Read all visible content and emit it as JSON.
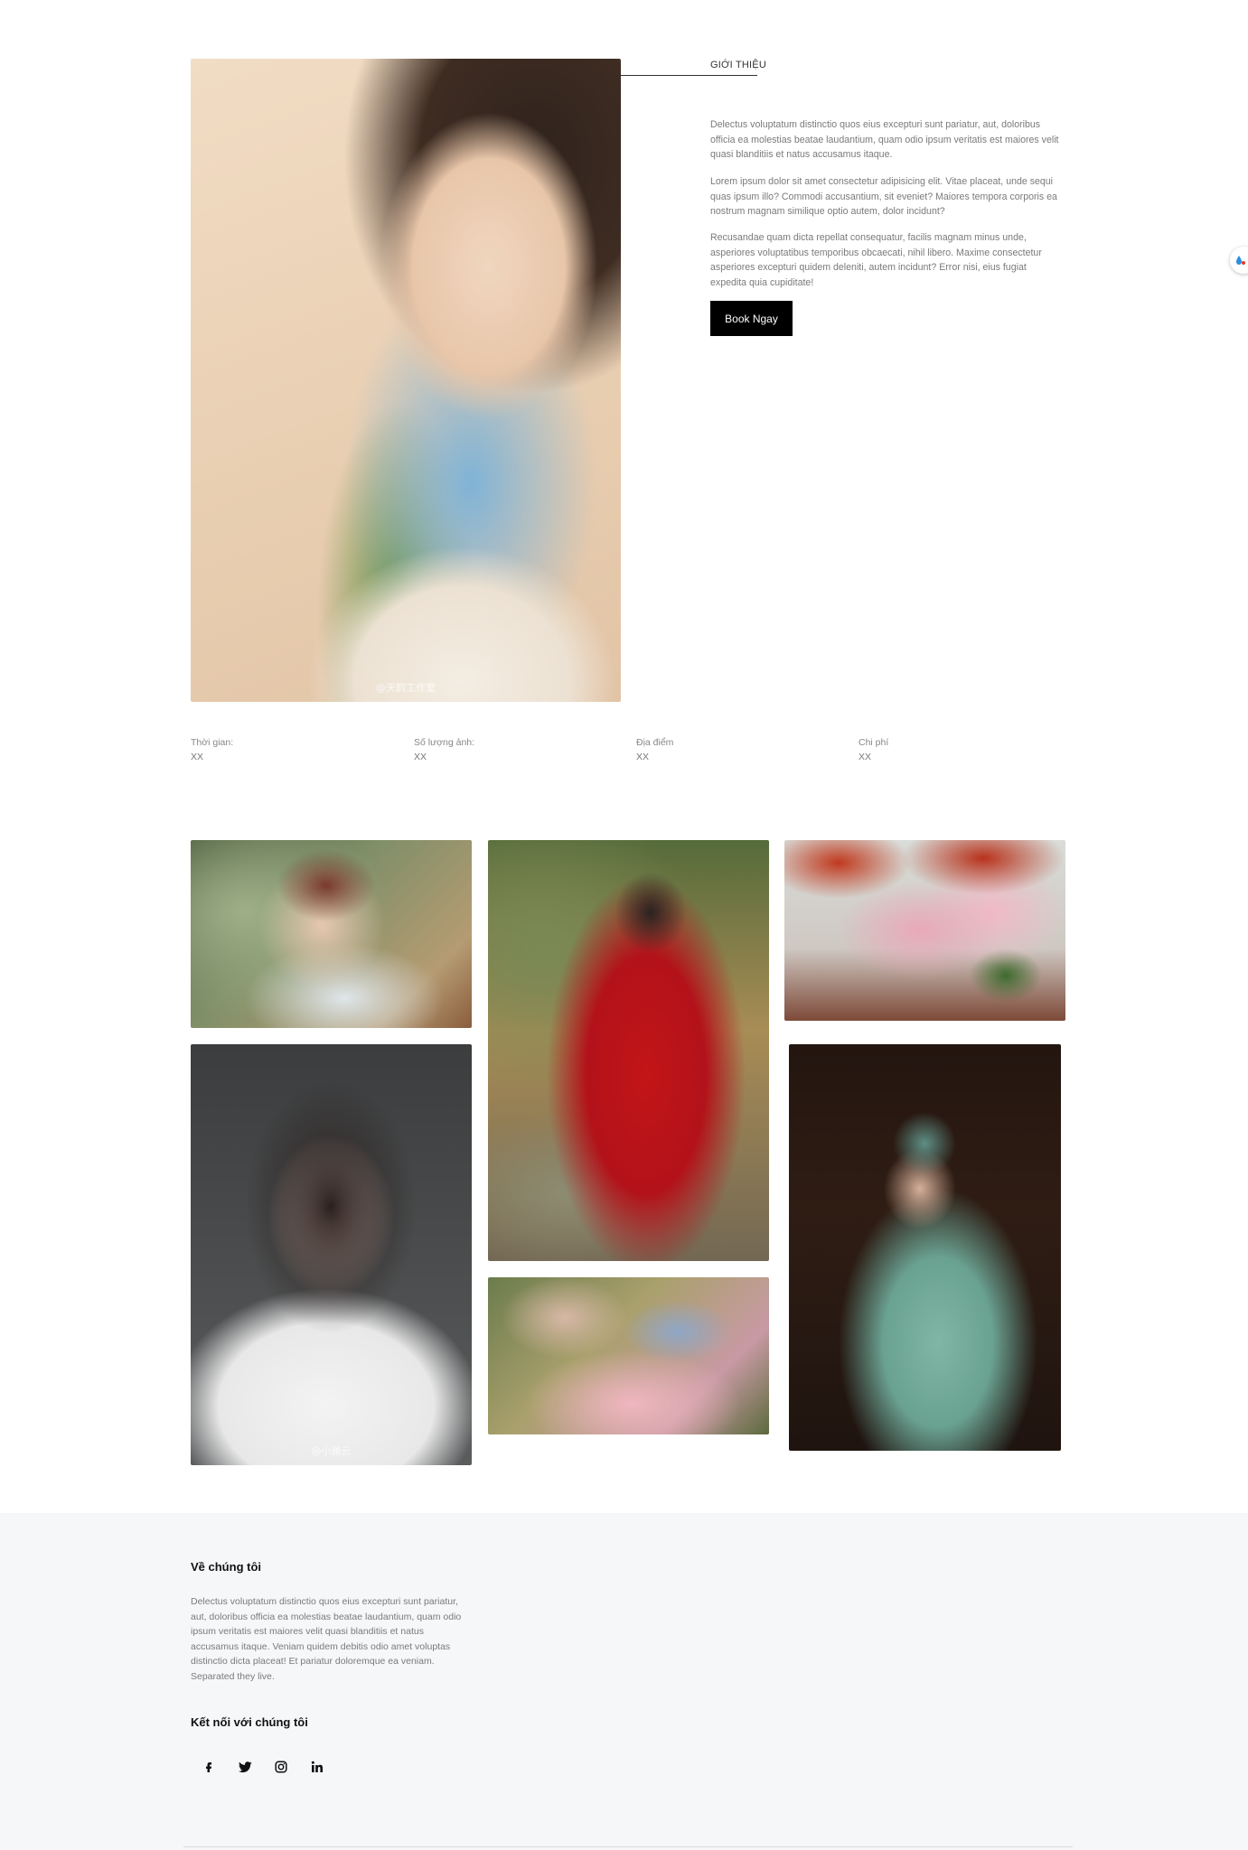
{
  "hero": {
    "watermark": "@天韵工作室"
  },
  "intro": {
    "heading": "GIỚI THIỆU",
    "paragraphs": [
      "Delectus voluptatum distinctio quos eius excepturi sunt pariatur, aut, doloribus officia ea molestias beatae laudantium, quam odio ipsum veritatis est maiores velit quasi blanditiis et natus accusamus itaque.",
      "Lorem ipsum dolor sit amet consectetur adipisicing elit. Vitae placeat, unde sequi quas ipsum illo? Commodi accusantium, sit eveniet? Maiores tempora corporis ea nostrum magnam similique optio autem, dolor incidunt?",
      "Recusandae quam dicta repellat consequatur, facilis magnam minus unde, asperiores voluptatibus temporibus obcaecati, nihil libero. Maxime consectetur asperiores excepturi quidem deleniti, autem incidunt? Error nisi, eius fugiat expedita quia cupiditate!"
    ],
    "button_label": "Book Ngay"
  },
  "stats": [
    {
      "label": "Thời gian:",
      "value": "XX"
    },
    {
      "label": "Số lượng ảnh:",
      "value": "XX"
    },
    {
      "label": "Địa điểm",
      "value": "XX"
    },
    {
      "label": "Chi phí",
      "value": "XX"
    }
  ],
  "gallery": {
    "photo4_watermark": "@小雅云"
  },
  "footer": {
    "about_title": "Về chúng tôi",
    "about_text": "Delectus voluptatum distinctio quos eius excepturi sunt pariatur, aut, doloribus officia ea molestias beatae laudantium, quam odio ipsum veritatis est maiores velit quasi blanditiis et natus accusamus itaque. Veniam quidem debitis odio amet voluptas distinctio dicta placeat! Et pariatur doloremque ea veniam. Separated they live.",
    "connect_title": "Kết nối với chúng tôi",
    "social_icons": [
      "facebook-icon",
      "twitter-icon",
      "instagram-icon",
      "linkedin-icon"
    ]
  }
}
